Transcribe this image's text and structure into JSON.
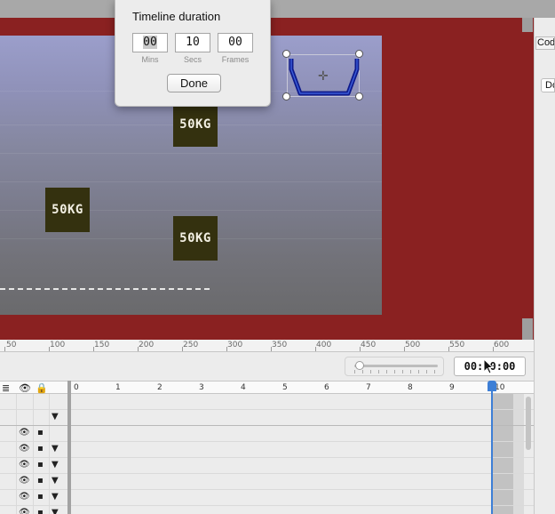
{
  "popover": {
    "title": "Timeline duration",
    "fields": [
      {
        "value": "00",
        "label": "Mins"
      },
      {
        "value": "10",
        "label": "Secs"
      },
      {
        "value": "00",
        "label": "Frames"
      }
    ],
    "done_label": "Done"
  },
  "stage": {
    "weights": [
      "50KG",
      "50KG",
      "50KG"
    ],
    "selected_object": "bucket"
  },
  "side": {
    "tab_label": "Code",
    "button_label": "Do"
  },
  "ruler": {
    "labels": [
      "50",
      "100",
      "150",
      "200",
      "250",
      "300",
      "350",
      "400",
      "450",
      "500",
      "550",
      "600"
    ]
  },
  "timeline": {
    "time_display": "00:10:00",
    "zoom_level": 0.05,
    "second_marks": [
      "0",
      "1",
      "2",
      "3",
      "4",
      "5",
      "6",
      "7",
      "8",
      "9",
      "10"
    ],
    "header_icons": [
      "layers-icon",
      "eye-icon",
      "lock-icon"
    ]
  },
  "colors": {
    "stage_background": "#8a2121",
    "playhead": "#3d7fd6",
    "weight_fill": "#34310f",
    "bucket_stroke": "#0e1a8c"
  }
}
